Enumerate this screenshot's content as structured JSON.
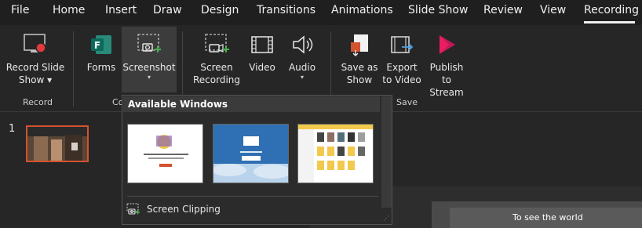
{
  "menu": {
    "tabs": [
      "File",
      "Home",
      "Insert",
      "Draw",
      "Design",
      "Transitions",
      "Animations",
      "Slide Show",
      "Review",
      "View",
      "Recording"
    ]
  },
  "ribbon": {
    "record_slide_show": {
      "line1": "Record Slide",
      "line2": "Show"
    },
    "forms": {
      "label": "Forms"
    },
    "screenshot": {
      "label": "Screenshot"
    },
    "screen_recording": {
      "line1": "Screen",
      "line2": "Recording"
    },
    "video": {
      "label": "Video"
    },
    "audio": {
      "label": "Audio"
    },
    "save_as_show": {
      "line1": "Save as",
      "line2": "Show"
    },
    "export_to_video": {
      "line1": "Export",
      "line2": "to Video"
    },
    "publish_to_stream": {
      "line1": "Publish",
      "line2": "to Stream"
    },
    "groups": {
      "record": "Record",
      "content": "Co",
      "save": "Save"
    }
  },
  "slides": {
    "number": "1"
  },
  "dropdown": {
    "header": "Available Windows",
    "screen_clipping": "Screen Clipping"
  },
  "canvas_text": "To see the world",
  "colors": {
    "accent": "#d35230",
    "background": "#262626"
  }
}
